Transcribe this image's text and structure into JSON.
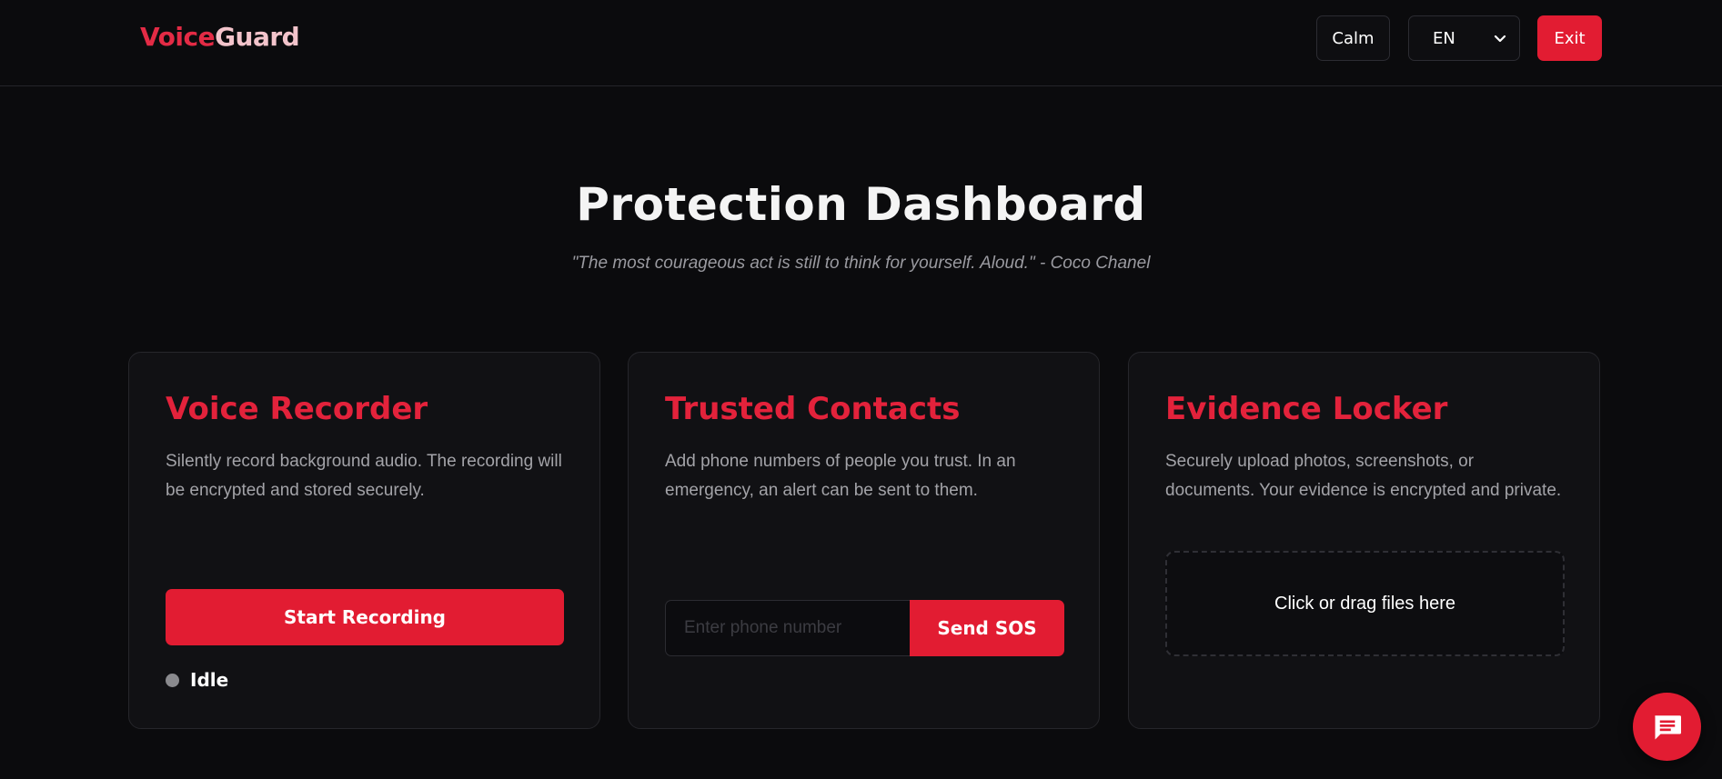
{
  "header": {
    "logo_part1": "Voice",
    "logo_part2": "Guard",
    "calm_label": "Calm",
    "language_value": "EN",
    "exit_label": "Exit"
  },
  "main": {
    "title": "Protection Dashboard",
    "quote": "\"The most courageous act is still to think for yourself. Aloud.\" - Coco Chanel"
  },
  "cards": [
    {
      "title": "Voice Recorder",
      "description": "Silently record background audio. The recording will be encrypted and stored securely.",
      "button_label": "Start Recording",
      "status": "Idle"
    },
    {
      "title": "Trusted Contacts",
      "description": "Add phone numbers of people you trust. In an emergency, an alert can be sent to them.",
      "input_placeholder": "Enter phone number",
      "button_label": "Send SOS"
    },
    {
      "title": "Evidence Locker",
      "description": "Securely upload photos, screenshots, or documents. Your evidence is encrypted and private.",
      "dropzone_label": "Click or drag files here"
    }
  ],
  "chat": {
    "icon": "chat-bubble-icon"
  },
  "colors": {
    "accent": "#e21c32",
    "background": "#0b0b0d",
    "card": "#111114",
    "status_idle": "#8a8a8e"
  }
}
